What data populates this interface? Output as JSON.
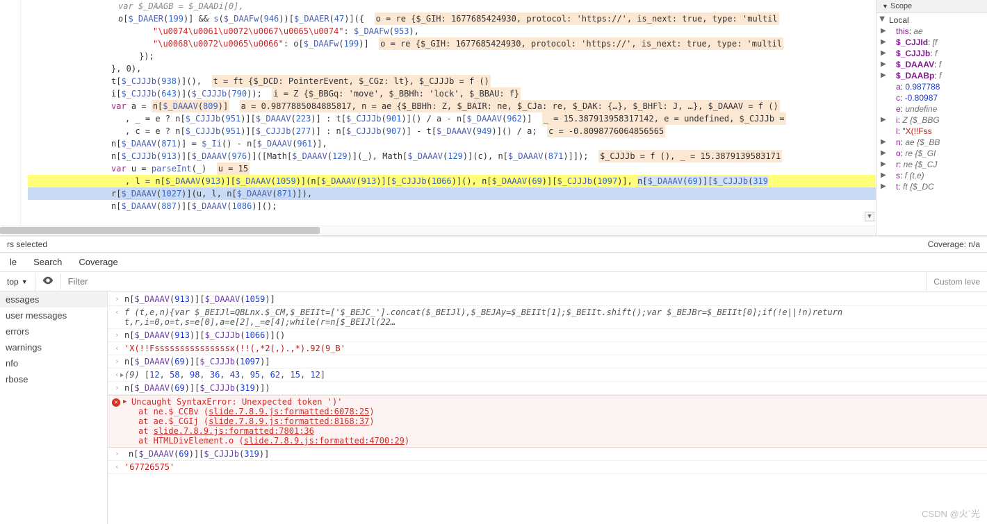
{
  "scope": {
    "title": "Scope",
    "local_label": "Local",
    "vars": [
      {
        "k": "this",
        "v": "ae",
        "t": "obj",
        "tri": true
      },
      {
        "k": "$_CJJId",
        "v": "[f",
        "t": "obj",
        "tri": true,
        "bold": true
      },
      {
        "k": "$_CJJJb",
        "v": "f",
        "t": "fn",
        "tri": true,
        "bold": true
      },
      {
        "k": "$_DAAAV",
        "v": "f",
        "t": "fn",
        "tri": true,
        "bold": true
      },
      {
        "k": "$_DAABp",
        "v": "f",
        "t": "fn",
        "tri": true,
        "bold": true
      },
      {
        "k": "a",
        "v": "0.987788",
        "t": "num"
      },
      {
        "k": "c",
        "v": "-0.80987",
        "t": "num"
      },
      {
        "k": "e",
        "v": "undefine",
        "t": "obj"
      },
      {
        "k": "i",
        "v": "Z {$_BBG",
        "t": "obj",
        "tri": true
      },
      {
        "k": "l",
        "v": "\"X(!!Fss",
        "t": "str"
      },
      {
        "k": "n",
        "v": "ae {$_BB",
        "t": "obj",
        "tri": true
      },
      {
        "k": "o",
        "v": "re {$_GI",
        "t": "obj",
        "tri": true
      },
      {
        "k": "r",
        "v": "ne {$_CJ",
        "t": "obj",
        "tri": true
      },
      {
        "k": "s",
        "v": "f (t,e)",
        "t": "fn",
        "tri": true
      },
      {
        "k": "t",
        "v": "ft {$_DC",
        "t": "obj",
        "tri": true
      }
    ]
  },
  "code": {
    "l0": "var $_DAAGB = $_DAADi[0],",
    "l1a": "o[$_DAAER(199)] && s($_DAAFw(946))[$_DAAER(47)]({",
    "l1b": "o = re {$_GIH: 1677685424930, protocol: 'https://', is_next: true, type: 'multil",
    "l2a": "\"\\u0074\\u0061\\u0072\\u0067\\u0065\\u0074\": $_DAAFw(953),",
    "l3a": "\"\\u0068\\u0072\\u0065\\u0066\": o[$_DAAFw(199)]",
    "l3b": "o = re {$_GIH: 1677685424930, protocol: 'https://', is_next: true, type: 'multil",
    "l4": "});",
    "l5": "}, 0),",
    "l6a": "t[$_CJJJb(938)](),",
    "l6b": "t = ft {$_DCD: PointerEvent, $_CGz: lt}, $_CJJJb = f ()",
    "l7a": "i[$_CJJJb(643)]($_CJJJb(790));",
    "l7b": "i = Z {$_BBGq: 'move', $_BBHh: 'lock', $_BBAU: f}",
    "l8a": "var a = n[$_DAAAV(809)]",
    "l8b": "a = 0.9877885084885817, n = ae {$_BBHh: Z, $_BAIR: ne, $_CJa: re, $_DAK: {…}, $_BHFl: J, …}, $_DAAAV = f ()",
    "l9a": ", _ = e ? n[$_CJJJb(951)][$_DAAAV(223)] : t[$_CJJJb(901)]() / a - n[$_DAAAV(962)]",
    "l9b": "_ = 15.387913958317142, e = undefined, $_CJJJb =",
    "l10a": ", c = e ? n[$_CJJJb(951)][$_CJJJb(277)] : n[$_CJJJb(907)] - t[$_DAAAV(949)]() / a;",
    "l10b": "c = -0.8098776064856565",
    "l11": "n[$_DAAAV(871)] = $_Ii() - n[$_DAAAV(961)],",
    "l12a": "n[$_CJJJb(913)][$_DAAAV(976)]([Math[$_DAAAV(129)](_), Math[$_DAAAV(129)](c), n[$_DAAAV(871)]]);",
    "l12b": "$_CJJJb = f (), _ = 15.3879139583171",
    "l13a": "var u = parseInt(_)",
    "l13b": "u = 15",
    "l14": ", l = n[$_DAAAV(913)][$_DAAAV(1059)](n[$_DAAAV(913)][$_CJJJb(1066)](), n[$_DAAAV(69)][$_CJJJb(1097)], n[$_DAAAV(69)][$_CJJJb(319",
    "l15": "r[$_DAAAV(1027)](u, l, n[$_DAAAV(871)]),",
    "l16": "n[$_DAAAV(887)][$_DAAAV(1086)]();"
  },
  "status": {
    "left": "rs selected",
    "right": "Coverage: n/a"
  },
  "tabs": {
    "t1": "le",
    "t2": "Search",
    "t3": "Coverage"
  },
  "filter": {
    "top": "top",
    "placeholder": "Filter",
    "levels": "Custom leve"
  },
  "sidebar": {
    "items": [
      "essages",
      "user messages",
      "errors",
      "warnings",
      "nfo",
      "rbose"
    ]
  },
  "console": {
    "e1_in": "n[$_DAAAV(913)][$_DAAAV(1059)]",
    "e1_out": "f (t,e,n){var $_BEIJl=QBLnx.$_CM,$_BEIIt=['$_BEJC_'].concat($_BEIJl),$_BEJAy=$_BEIIt[1];$_BEIIt.shift();var $_BEJBr=$_BEIIt[0];if(!e||!n)return t,r,i=0,o=t,s=e[0],a=e[2],_=e[4];while(r=n[$_BEIJl(22…",
    "e2_in": "n[$_DAAAV(913)][$_CJJJb(1066)]()",
    "e2_out": "'X(!!Fsssssssssssssssx(!!(,*2(,).,*).92(9_B'",
    "e3_in": "n[$_DAAAV(69)][$_CJJJb(1097)]",
    "e3_out_prefix": "(9)",
    "e3_out_arr": "[12, 58, 98, 36, 43, 95, 62, 15, 12]",
    "e4_in": "n[$_DAAAV(69)][$_CJJJb(319)])",
    "err_title": "Uncaught SyntaxError: Unexpected token ')'",
    "err_at1_pre": "at ne.$_CCBv (",
    "err_at1_link": "slide.7.8.9.js:formatted:6078:25",
    "err_at2_pre": "at ae.$_CGIj (",
    "err_at2_link": "slide.7.8.9.js:formatted:8168:37",
    "err_at3_pre": "at ",
    "err_at3_link": "slide.7.8.9.js:formatted:7801:36",
    "err_at4_pre": "at HTMLDivElement.o (",
    "err_at4_link": "slide.7.8.9.js:formatted:4700:29",
    "e5_in": "n[$_DAAAV(69)][$_CJJJb(319)]",
    "e5_out": "'67726575'"
  },
  "watermark": "CSDN @火`光"
}
